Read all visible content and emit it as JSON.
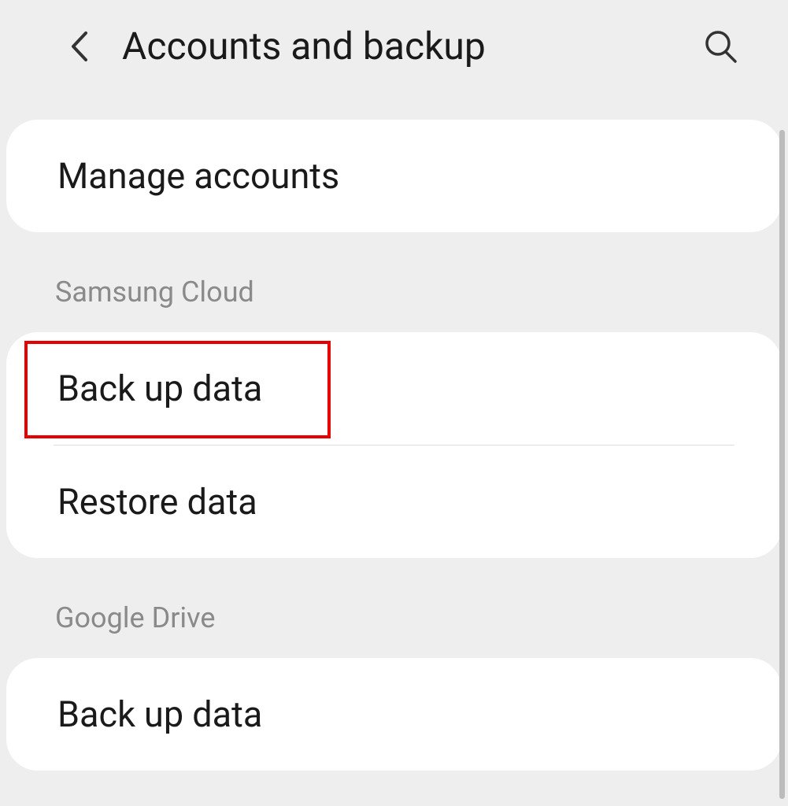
{
  "header": {
    "title": "Accounts and backup"
  },
  "sections": {
    "top": {
      "items": [
        {
          "label": "Manage accounts"
        }
      ]
    },
    "samsung_cloud": {
      "header": "Samsung Cloud",
      "items": [
        {
          "label": "Back up data"
        },
        {
          "label": "Restore data"
        }
      ]
    },
    "google_drive": {
      "header": "Google Drive",
      "items": [
        {
          "label": "Back up data"
        }
      ]
    }
  }
}
